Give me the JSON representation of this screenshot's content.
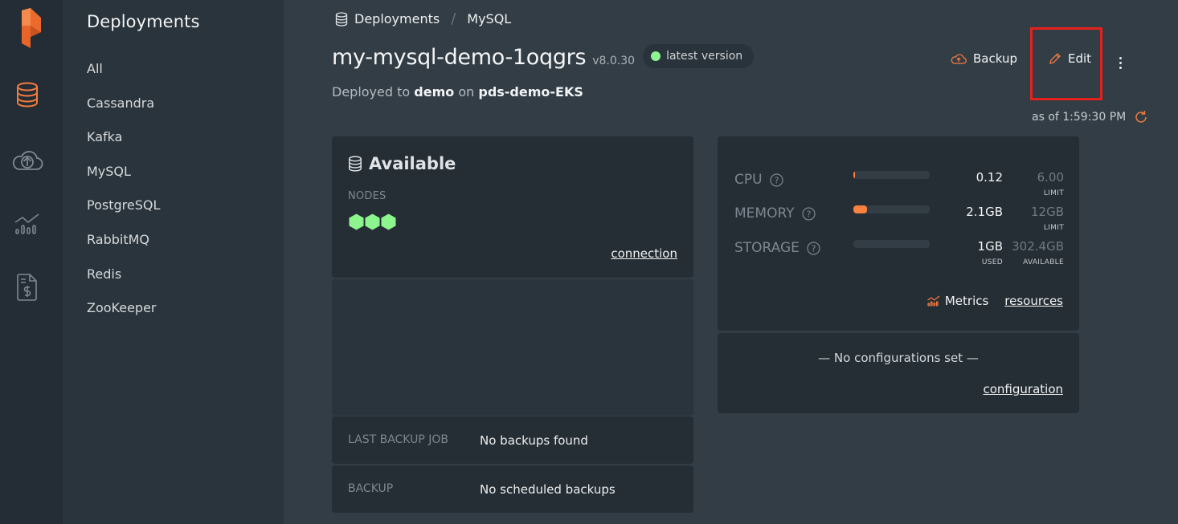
{
  "app": {
    "accent_color": "#f37b3f",
    "logo": "portworx-logo"
  },
  "rail": {
    "items": [
      {
        "icon": "database-icon",
        "active": true
      },
      {
        "icon": "cloud-upload-icon",
        "active": false
      },
      {
        "icon": "metrics-chart-icon",
        "active": false
      },
      {
        "icon": "billing-document-icon",
        "active": false
      }
    ]
  },
  "sidebar": {
    "title": "Deployments",
    "items": [
      {
        "label": "All"
      },
      {
        "label": "Cassandra"
      },
      {
        "label": "Kafka"
      },
      {
        "label": "MySQL"
      },
      {
        "label": "PostgreSQL"
      },
      {
        "label": "RabbitMQ"
      },
      {
        "label": "Redis"
      },
      {
        "label": "ZooKeeper"
      }
    ]
  },
  "breadcrumb": {
    "items": [
      "Deployments",
      "MySQL"
    ],
    "separator": "/"
  },
  "deployment": {
    "name": "my-mysql-demo-1oqgrs",
    "version": "v8.0.30",
    "version_badge": "latest version",
    "version_badge_color": "#8df58e",
    "deployed_prefix": "Deployed to",
    "namespace": "demo",
    "on_word": "on",
    "cluster": "pds-demo-EKS"
  },
  "actions": {
    "backup_label": "Backup",
    "edit_label": "Edit",
    "more_icon": "kebab-menu-icon",
    "as_of": "as of 1:59:30 PM",
    "refresh_icon": "refresh-icon"
  },
  "status_card": {
    "status": "Available",
    "nodes_label": "NODES",
    "node_count": 3,
    "node_color": "#8df58e",
    "connection_link": "connection"
  },
  "backup_info": {
    "rows": [
      {
        "label": "LAST BACKUP JOB",
        "value": "No backups found"
      },
      {
        "label": "BACKUP",
        "value": "No scheduled backups"
      }
    ]
  },
  "resources": {
    "rows": [
      {
        "name": "CPU",
        "used": "0.12",
        "limit": "6.00",
        "used_caption": "",
        "limit_caption": "LIMIT",
        "fraction": 0.02
      },
      {
        "name": "MEMORY",
        "used": "2.1GB",
        "limit": "12GB",
        "used_caption": "",
        "limit_caption": "LIMIT",
        "fraction": 0.175
      },
      {
        "name": "STORAGE",
        "used": "1GB",
        "limit": "302.4GB",
        "used_caption": "USED",
        "limit_caption": "AVAILABLE",
        "fraction": 0.003
      }
    ],
    "metrics_label": "Metrics",
    "resources_link": "resources"
  },
  "configuration": {
    "empty_text": "— No configurations set —",
    "link": "configuration"
  }
}
